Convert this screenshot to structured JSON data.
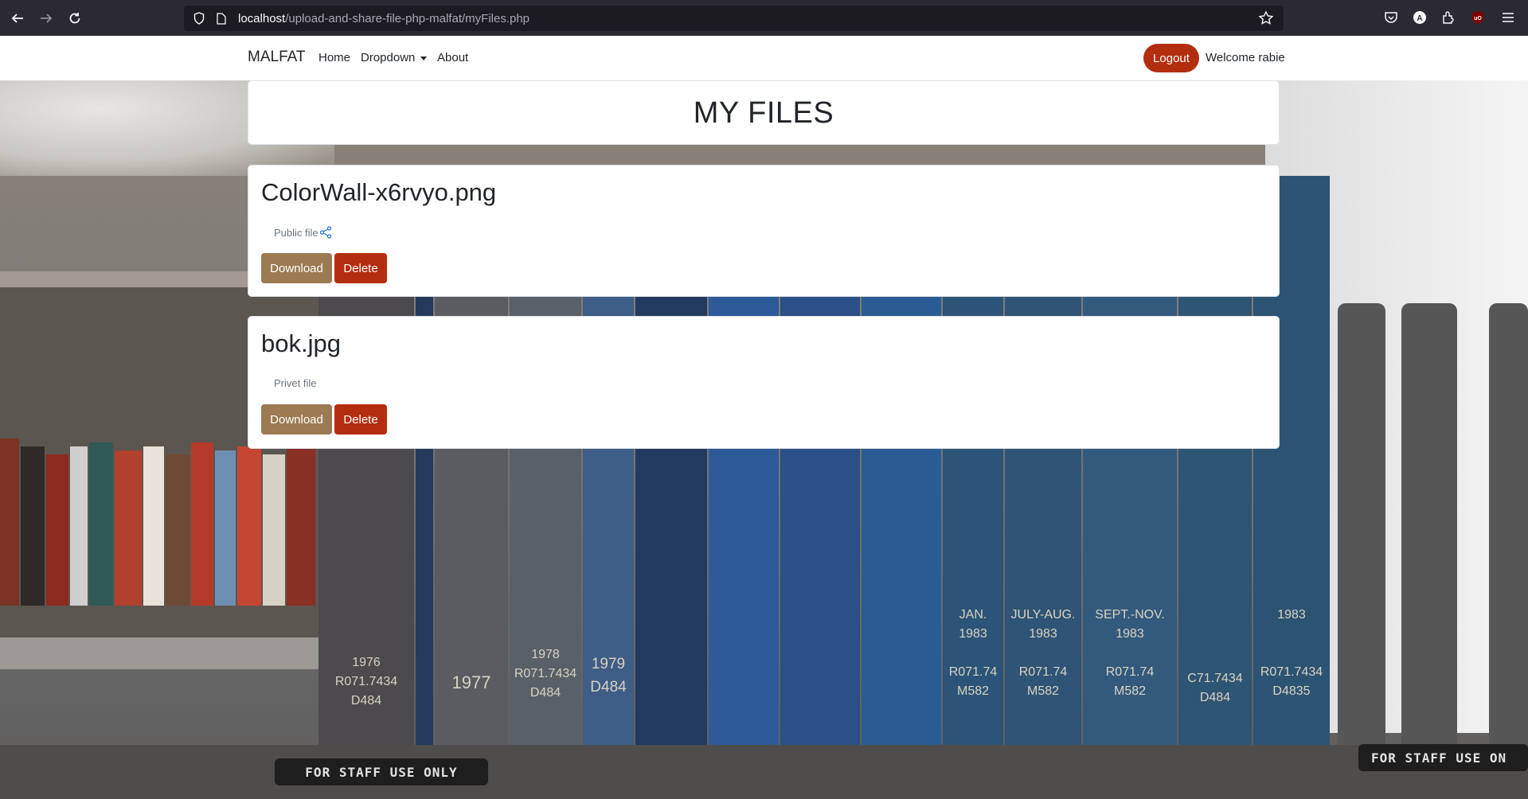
{
  "browser": {
    "url_host": "localhost",
    "url_path": "/upload-and-share-file-php-malfat/myFiles.php"
  },
  "navbar": {
    "brand": "MALFAT",
    "links": [
      "Home",
      "Dropdown",
      "About"
    ],
    "logout_label": "Logout",
    "welcome_text": "Welcome rabie"
  },
  "page": {
    "title": "MY FILES"
  },
  "files": [
    {
      "name": "ColorWall-x6rvyo.png",
      "visibility": "Public file",
      "shareable": true,
      "download_label": "Download",
      "delete_label": "Delete"
    },
    {
      "name": "bok.jpg",
      "visibility": "Privet file",
      "shareable": false,
      "download_label": "Download",
      "delete_label": "Delete"
    }
  ],
  "background_labels": {
    "staff_plate": "FOR STAFF USE ONLY",
    "staff_plate_right": "FOR STAFF USE ON"
  },
  "colors": {
    "logout": "#b32d0f",
    "download": "#9c7a52",
    "delete": "#b32d0f",
    "share_icon": "#1a73e8"
  },
  "icons": [
    "back-arrow-icon",
    "forward-arrow-icon",
    "reload-icon",
    "shield-icon",
    "page-icon",
    "bookmark-star-icon",
    "pocket-icon",
    "account-icon",
    "extensions-icon",
    "ublock-icon",
    "menu-icon",
    "share-icon"
  ]
}
